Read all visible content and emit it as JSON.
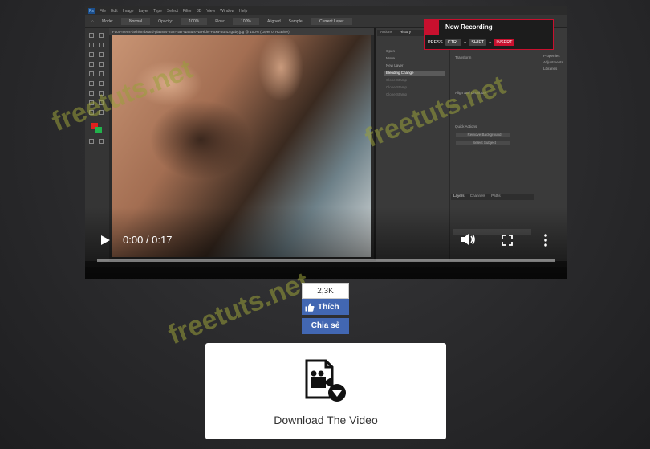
{
  "photoshop": {
    "menu": [
      "File",
      "Edit",
      "Image",
      "Layer",
      "Type",
      "Select",
      "Filter",
      "3D",
      "View",
      "Window",
      "Help"
    ],
    "options": {
      "mode_label": "Mode:",
      "mode_value": "Normal",
      "opacity_label": "Opacity:",
      "opacity_value": "100%",
      "flow_label": "Flow:",
      "flow_value": "100%",
      "aligned": "Aligned",
      "sample_label": "Sample:",
      "sample_value": "Current Layer"
    },
    "doc_tab": "Face-mens-fashion-beard-glasses-man-hair-NaBuIs-NaHidIs-Poxa-BunL4gaby.jpg @ 100% (Layer 0, RGB/8#)",
    "history_tabs": [
      "Actions",
      "History"
    ],
    "history_items": [
      "Open",
      "Move",
      "New Layer",
      "Blending Change",
      "Clone Stamp",
      "Clone Stamp",
      "Clone Stamp"
    ],
    "properties_sections": [
      "Transform",
      "Align and Distribute",
      "Quick Actions"
    ],
    "quick_buttons": [
      "Remove Background",
      "Select Subject"
    ],
    "layers_tabs": [
      "Layers",
      "Channels",
      "Paths"
    ],
    "right_labels": [
      "Properties",
      "Adjustments",
      "Libraries"
    ]
  },
  "recording": {
    "title": "Now Recording",
    "press": "PRESS",
    "key1": "CTRL",
    "key2": "SHIFT",
    "key3": "INSERT",
    "accent": "#c8102e"
  },
  "video": {
    "current_time": "0:00",
    "separator": " / ",
    "duration": "0:17",
    "time_display": "0:00 / 0:17",
    "progress": 0
  },
  "watermark": "freetuts.net",
  "social": {
    "like_count": "2,3K",
    "like_label": "Thích",
    "share_label": "Chia sẻ",
    "brand_color": "#4267b2"
  },
  "download": {
    "label": "Download The Video",
    "icon": "video-file-download-icon"
  }
}
